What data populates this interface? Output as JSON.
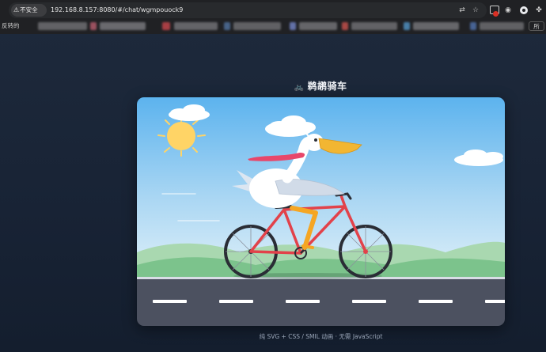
{
  "browser": {
    "security_label": "不安全",
    "url": "192.168.8.157:8080/#/chat/wgmpouock9",
    "bookmark_text": "反转的",
    "bookmark_right": "所"
  },
  "page": {
    "title": "鹈鹕骑车",
    "caption": "纯 SVG + CSS / SMIL 动画 · 无需 JavaScript"
  },
  "scene": {
    "sky_top": "#5fb5ee",
    "sky_bottom": "#d8ecf8",
    "sun_color": "#ffd466",
    "hill_color": "#7fc48f",
    "road_color": "#4a4f5c",
    "lane_color": "#ffffff",
    "bike_frame_color": "#e2424a",
    "scarf_color": "#e8476a",
    "beak_color": "#f2b632",
    "body_color": "#ffffff",
    "wing_color": "#cfd9e6",
    "leg_color": "#f5a623"
  }
}
